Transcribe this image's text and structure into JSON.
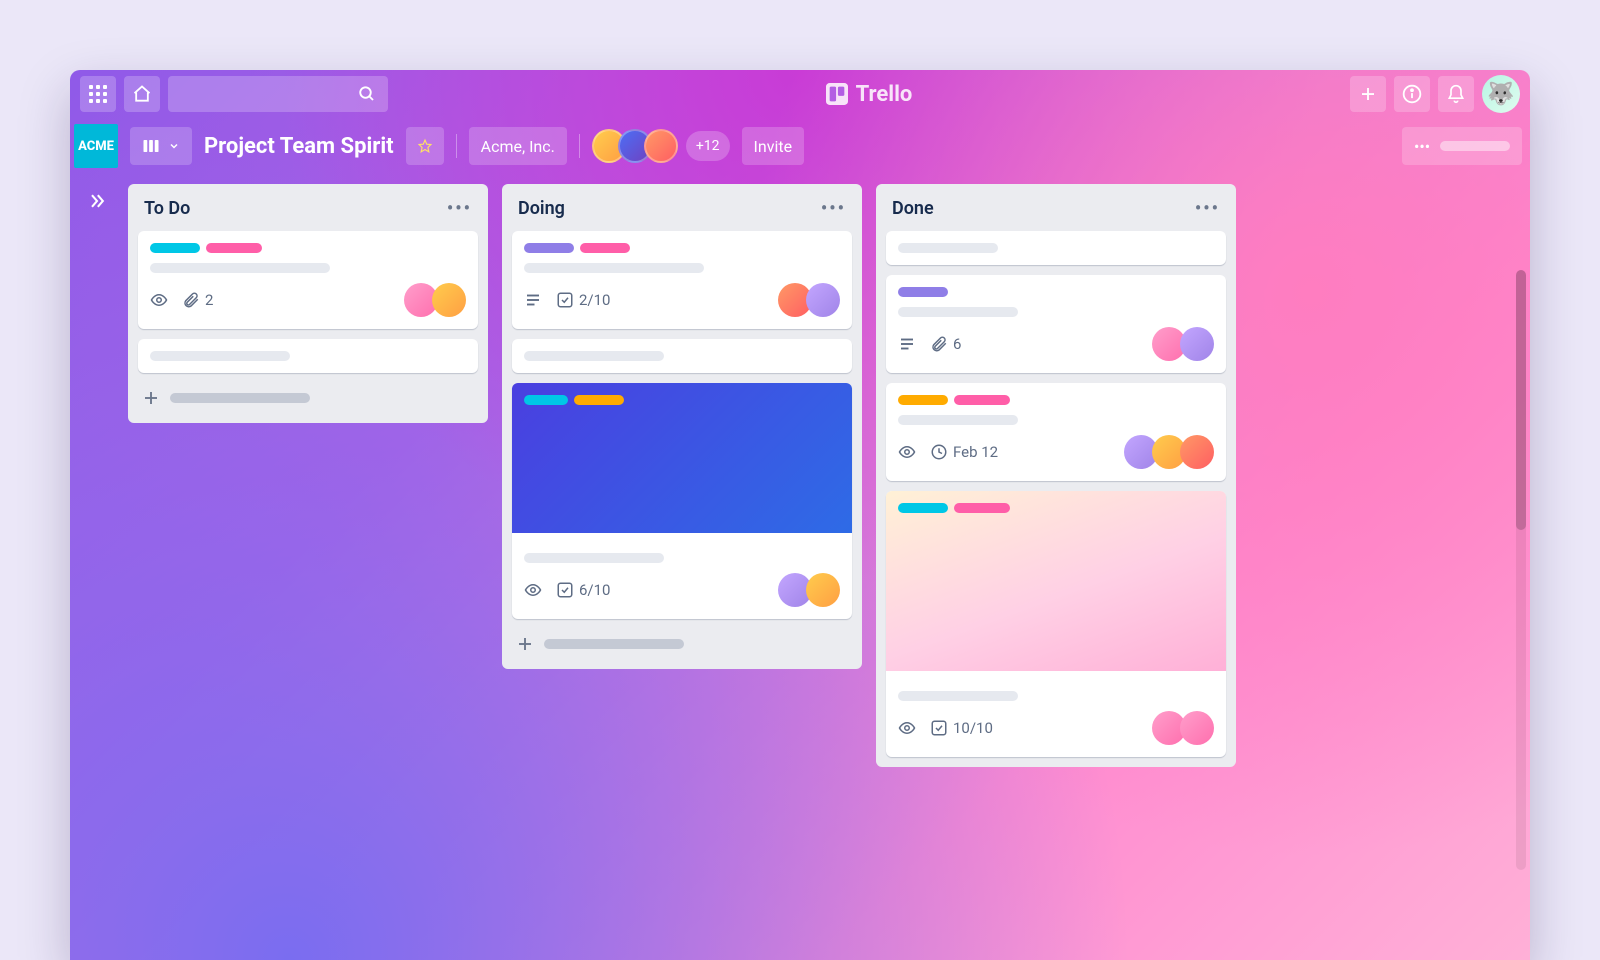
{
  "topbar": {
    "brand": "Trello"
  },
  "boardbar": {
    "workspace_badge": "ACME",
    "title": "Project Team Spirit",
    "org": "Acme, Inc.",
    "extra_members": "+12",
    "invite": "Invite"
  },
  "lists": [
    {
      "title": "To Do",
      "cards": [
        {
          "attachments": "2"
        }
      ]
    },
    {
      "title": "Doing",
      "cards": [
        {
          "checklist": "2/10"
        },
        {
          "checklist": "6/10"
        }
      ]
    },
    {
      "title": "Done",
      "cards": [
        {
          "attachments": "6"
        },
        {
          "due": "Feb 12"
        },
        {
          "checklist": "10/10"
        }
      ]
    }
  ]
}
